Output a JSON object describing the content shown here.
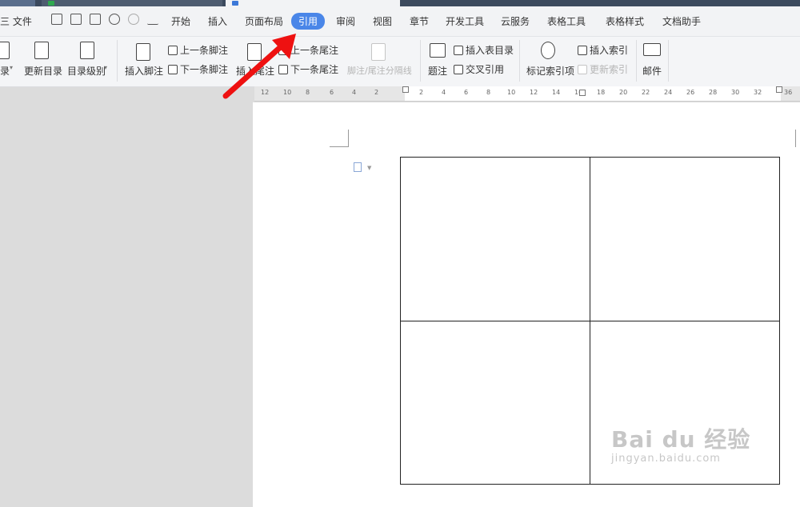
{
  "menubar": {
    "file_label": "三 文件",
    "items": [
      "开始",
      "插入",
      "页面布局",
      "引用",
      "审阅",
      "视图",
      "章节",
      "开发工具",
      "云服务",
      "表格工具",
      "表格样式",
      "文档助手"
    ],
    "active_item": "引用"
  },
  "ribbon": {
    "toc_label": "录",
    "update_toc": "更新目录",
    "toc_level": "目录级别",
    "insert_footnote": "插入脚注",
    "prev_footnote": "上一条脚注",
    "next_footnote": "下一条脚注",
    "insert_endnote": "插入尾注",
    "prev_endnote": "上一条尾注",
    "next_endnote": "下一条尾注",
    "separator_line": "脚注/尾注分隔线",
    "caption": "题注",
    "insert_table_of_figures": "插入表目录",
    "cross_reference": "交叉引用",
    "mark_index_entry": "标记索引项",
    "insert_index": "插入索引",
    "update_index": "更新索引",
    "mail": "邮件"
  },
  "ruler": {
    "ticks": [
      "12",
      "10",
      "8",
      "6",
      "4",
      "2",
      "2",
      "4",
      "6",
      "8",
      "10",
      "12",
      "14",
      "16",
      "18",
      "20",
      "22",
      "24",
      "26",
      "28",
      "30",
      "32",
      "36"
    ]
  },
  "document": {
    "table_rows": 2,
    "table_cols": 2
  },
  "watermark": {
    "main": "Bai du 经验",
    "sub": "jingyan.baidu.com"
  },
  "colors": {
    "accent": "#4a86e8",
    "arrow": "#ee1111"
  }
}
